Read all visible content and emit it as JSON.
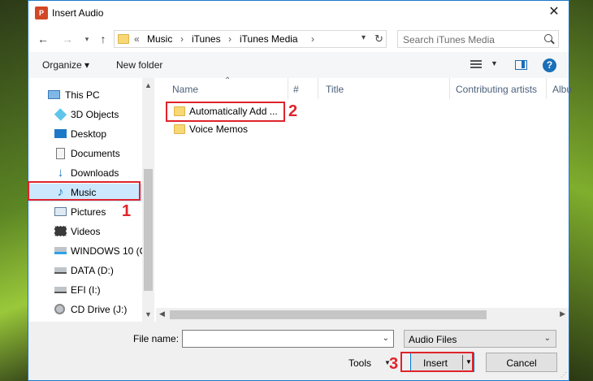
{
  "window": {
    "title": "Insert Audio",
    "app_icon_text": "P"
  },
  "address_bar": {
    "prefix": "«",
    "segments": [
      "Music",
      "iTunes",
      "iTunes Media"
    ]
  },
  "search": {
    "placeholder": "Search iTunes Media"
  },
  "toolbar": {
    "organize_label": "Organize ▾",
    "new_folder_label": "New folder"
  },
  "nav_pane": {
    "items": [
      {
        "label": "This PC",
        "icon": "computer-icon"
      },
      {
        "label": "3D Objects",
        "icon": "cube-icon"
      },
      {
        "label": "Desktop",
        "icon": "desktop-icon"
      },
      {
        "label": "Documents",
        "icon": "document-icon"
      },
      {
        "label": "Downloads",
        "icon": "download-icon"
      },
      {
        "label": "Music",
        "icon": "music-icon",
        "selected": true
      },
      {
        "label": "Pictures",
        "icon": "picture-icon"
      },
      {
        "label": "Videos",
        "icon": "video-icon"
      },
      {
        "label": "WINDOWS 10 (C",
        "icon": "drive-icon"
      },
      {
        "label": "DATA (D:)",
        "icon": "drive-icon"
      },
      {
        "label": "EFI (I:)",
        "icon": "drive-icon"
      },
      {
        "label": "CD Drive (J:)",
        "icon": "cd-drive-icon"
      }
    ]
  },
  "file_list": {
    "columns": [
      "Name",
      "#",
      "Title",
      "Contributing artists",
      "Albu"
    ],
    "rows": [
      {
        "name": "Automatically Add ...",
        "icon": "folder-icon"
      },
      {
        "name": "Voice Memos",
        "icon": "folder-icon"
      }
    ]
  },
  "bottom_bar": {
    "file_name_label": "File name:",
    "file_name_value": "",
    "file_type_filter": "Audio Files",
    "tools_label": "Tools",
    "insert_label": "Insert",
    "cancel_label": "Cancel"
  },
  "callouts": {
    "step1": "1",
    "step2": "2",
    "step3": "3"
  },
  "colors": {
    "callout_red": "#e0232a",
    "accent_blue": "#0078d7",
    "selection": "#cce8ff"
  }
}
